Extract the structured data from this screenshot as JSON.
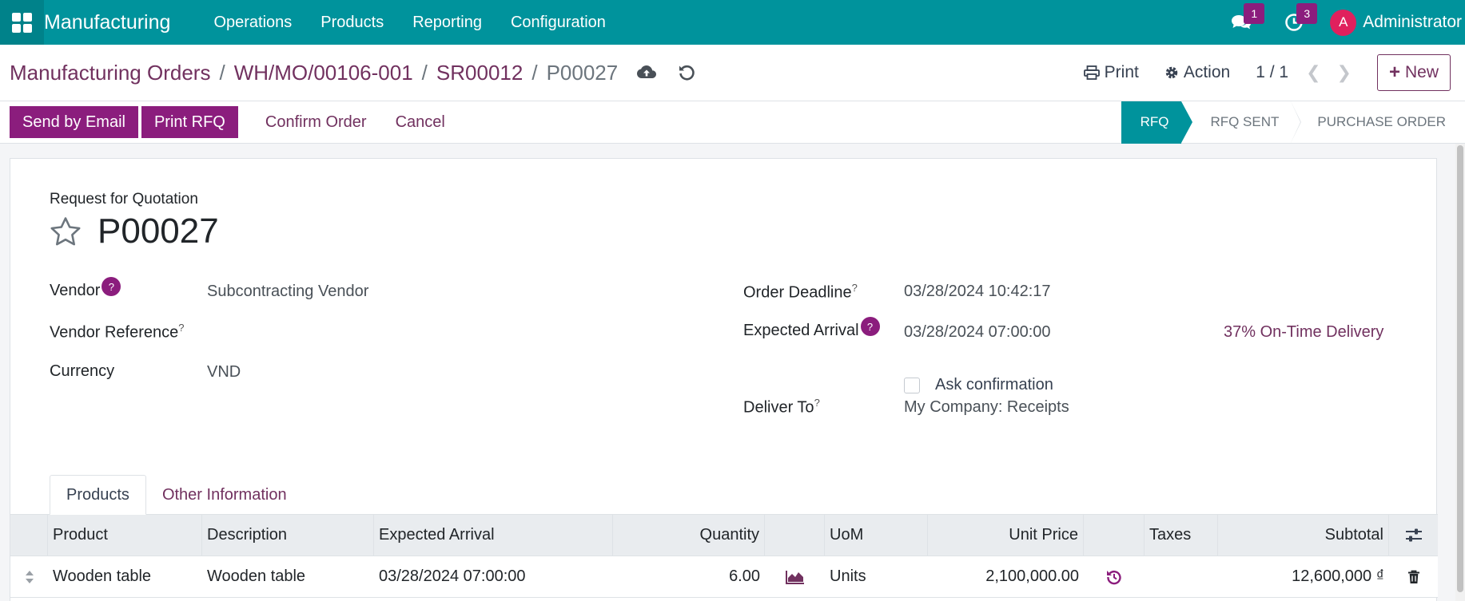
{
  "navbar": {
    "app_name": "Manufacturing",
    "menu": [
      "Operations",
      "Products",
      "Reporting",
      "Configuration"
    ],
    "messages_count": "1",
    "activities_count": "3",
    "user_initial": "A",
    "user_name": "Administrator"
  },
  "breadcrumb": {
    "items": [
      "Manufacturing Orders",
      "WH/MO/00106-001",
      "SR00012"
    ],
    "separator": "/",
    "current": "P00027"
  },
  "control": {
    "print_label": "Print",
    "action_label": "Action",
    "pager": "1 / 1",
    "new_label": "New"
  },
  "actions": {
    "send_email": "Send by Email",
    "print_rfq": "Print RFQ",
    "confirm": "Confirm Order",
    "cancel": "Cancel"
  },
  "stages": [
    "RFQ",
    "RFQ Sent",
    "Purchase Order"
  ],
  "form": {
    "doc_type": "Request for Quotation",
    "name": "P00027",
    "vendor_label": "Vendor",
    "vendor_value": "Subcontracting Vendor",
    "vendor_ref_label": "Vendor Reference",
    "currency_label": "Currency",
    "currency_value": "VND",
    "order_deadline_label": "Order Deadline",
    "order_deadline_value": "03/28/2024 10:42:17",
    "expected_arrival_label": "Expected Arrival",
    "expected_arrival_value": "03/28/2024 07:00:00",
    "on_time": "37% On-Time Delivery",
    "ask_confirmation": "Ask confirmation",
    "deliver_to_label": "Deliver To",
    "deliver_to_value": "My Company: Receipts",
    "help_mark": "?"
  },
  "tabs": [
    "Products",
    "Other Information"
  ],
  "table": {
    "headers": [
      "Product",
      "Description",
      "Expected Arrival",
      "Quantity",
      "UoM",
      "Unit Price",
      "Taxes",
      "Subtotal"
    ],
    "rows": [
      {
        "product": "Wooden table",
        "description": "Wooden table",
        "expected_arrival": "03/28/2024 07:00:00",
        "quantity": "6.00",
        "uom": "Units",
        "unit_price": "2,100,000.00",
        "taxes": "",
        "subtotal": "12,600,000 ₫"
      }
    ]
  },
  "colors": {
    "navbar": "#00939c",
    "primary": "#8b1d7d",
    "link": "#71315f"
  }
}
